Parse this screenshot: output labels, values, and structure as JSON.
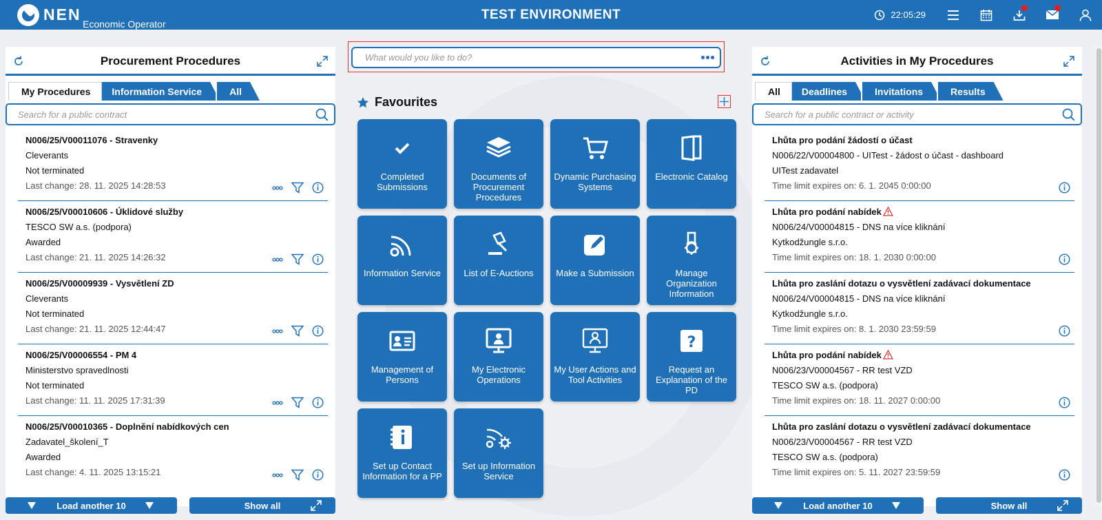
{
  "header": {
    "logo_name": "NEN",
    "logo_sub": "Economic Operator",
    "env_title": "TEST ENVIRONMENT",
    "time": "22:05:29",
    "accent": "#1f70b6"
  },
  "left_panel": {
    "title": "Procurement Procedures",
    "tabs": [
      "My Procedures",
      "Information Service",
      "All"
    ],
    "search_placeholder": "Search for a public contract",
    "items": [
      {
        "title": "N006/25/V00011076 - Stravenky",
        "org": "Cleverants",
        "status": "Not terminated",
        "change": "Last change: 28. 11. 2025 14:28:53"
      },
      {
        "title": "N006/25/V00010606 - Úklidové služby",
        "org": "TESCO SW a.s. (podpora)",
        "status": "Awarded",
        "change": "Last change: 21. 11. 2025 14:26:32"
      },
      {
        "title": "N006/25/V00009939 - Vysvětlení ZD",
        "org": "Cleverants",
        "status": "Not terminated",
        "change": "Last change: 21. 11. 2025 12:44:47"
      },
      {
        "title": "N006/25/V00006554 - PM 4",
        "org": "Ministerstvo spravedlnosti",
        "status": "Not terminated",
        "change": "Last change: 11. 11. 2025 17:31:39"
      },
      {
        "title": "N006/25/V00010365 - Doplnění nabídkových cen",
        "org": "Zadavatel_školení_T",
        "status": "Awarded",
        "change": "Last change: 4. 11. 2025 13:15:21"
      }
    ],
    "load_more": "Load another 10",
    "show_all": "Show all"
  },
  "center": {
    "search_placeholder": "What would you like to do?",
    "favourites_title": "Favourites",
    "tiles": [
      {
        "label": "Completed Submissions",
        "icon": "check-icon"
      },
      {
        "label": "Documents of Procurement Procedures",
        "icon": "layers-icon"
      },
      {
        "label": "Dynamic Purchasing Systems",
        "icon": "cart-icon"
      },
      {
        "label": "Electronic Catalog",
        "icon": "book-icon"
      },
      {
        "label": "Information Service",
        "icon": "feed-icon"
      },
      {
        "label": "List of E-Auctions",
        "icon": "gavel-icon"
      },
      {
        "label": "Make a Submission",
        "icon": "edit-icon"
      },
      {
        "label": "Manage Organization Information",
        "icon": "org-settings-icon"
      },
      {
        "label": "Management of Persons",
        "icon": "id-card-icon"
      },
      {
        "label": "My Electronic Operations",
        "icon": "monitor-user-icon"
      },
      {
        "label": "My User Actions and Tool Activities",
        "icon": "monitor-person-icon"
      },
      {
        "label": "Request an Explanation of the PD",
        "icon": "question-icon"
      },
      {
        "label": "Set up Contact Information for a PP",
        "icon": "contact-book-icon"
      },
      {
        "label": "Set up Information Service",
        "icon": "feed-settings-icon"
      }
    ]
  },
  "right_panel": {
    "title": "Activities in My Procedures",
    "tabs": [
      "All",
      "Deadlines",
      "Invitations",
      "Results"
    ],
    "search_placeholder": "Search for a public contract or activity",
    "items": [
      {
        "title": "Lhůta pro podání žádostí o účast",
        "warn": false,
        "proc": "N006/22/V00004800 - UITest - žádost o účast - dashboard",
        "org": "UITest zadavatel",
        "limit": "Time limit expires on: 6. 1. 2045 0:00:00"
      },
      {
        "title": "Lhůta pro podání nabídek",
        "warn": true,
        "proc": "N006/24/V00004815 - DNS na více kliknání",
        "org": "Kytkodžungle s.r.o.",
        "limit": "Time limit expires on: 18. 1. 2030 0:00:00"
      },
      {
        "title": "Lhůta pro zaslání dotazu o vysvětlení zadávací dokumentace",
        "warn": false,
        "proc": "N006/24/V00004815 - DNS na více kliknání",
        "org": "Kytkodžungle s.r.o.",
        "limit": "Time limit expires on: 8. 1. 2030 23:59:59"
      },
      {
        "title": "Lhůta pro podání nabídek",
        "warn": true,
        "proc": "N006/23/V00004567 - RR test VZD",
        "org": "TESCO SW a.s. (podpora)",
        "limit": "Time limit expires on: 18. 11. 2027 0:00:00"
      },
      {
        "title": "Lhůta pro zaslání dotazu o vysvětlení zadávací dokumentace",
        "warn": false,
        "proc": "N006/23/V00004567 - RR test VZD",
        "org": "TESCO SW a.s. (podpora)",
        "limit": "Time limit expires on: 5. 11. 2027 23:59:59"
      }
    ],
    "load_more": "Load another 10",
    "show_all": "Show all"
  }
}
